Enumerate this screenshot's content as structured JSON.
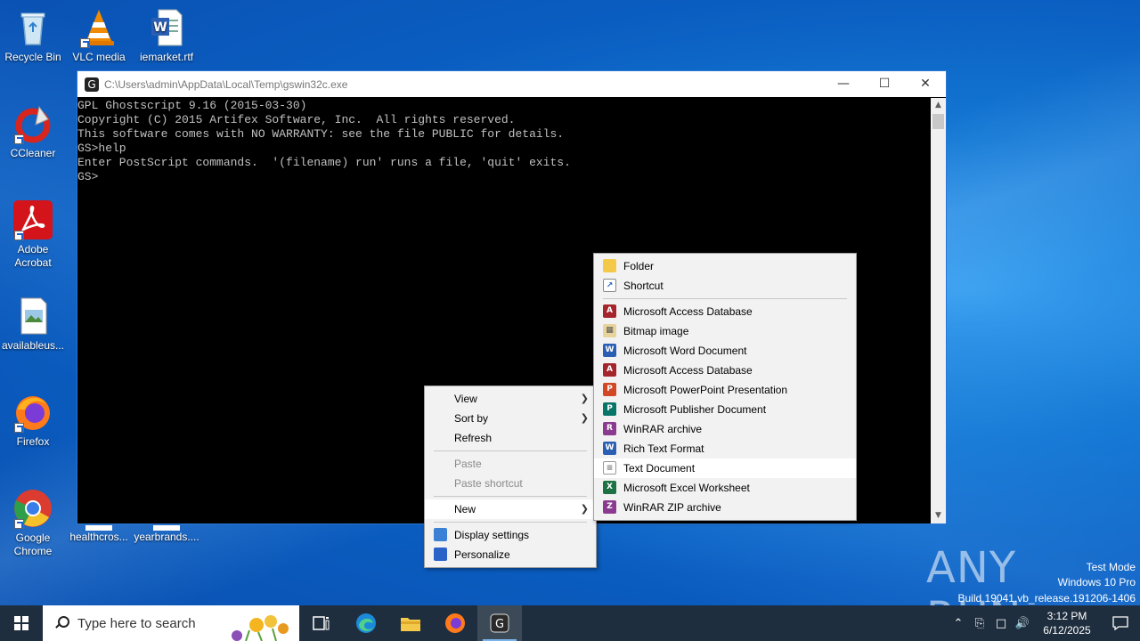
{
  "desktop": {
    "icons": [
      {
        "label": "Recycle Bin"
      },
      {
        "label": "VLC media"
      },
      {
        "label": "iemarket.rtf"
      },
      {
        "label": "CCleaner"
      },
      {
        "label": "Adobe Acrobat"
      },
      {
        "label": "availableus..."
      },
      {
        "label": "Firefox"
      },
      {
        "label": "Google Chrome"
      },
      {
        "label": "healthcros..."
      },
      {
        "label": "yearbrands...."
      }
    ]
  },
  "console": {
    "title": "C:\\Users\\admin\\AppData\\Local\\Temp\\gswin32c.exe",
    "lines": [
      "GPL Ghostscript 9.16 (2015-03-30)",
      "Copyright (C) 2015 Artifex Software, Inc.  All rights reserved.",
      "This software comes with NO WARRANTY: see the file PUBLIC for details.",
      "GS>help",
      "Enter PostScript commands.  '(filename) run' runs a file, 'quit' exits.",
      "GS>"
    ]
  },
  "context_menu": {
    "view": "View",
    "sort_by": "Sort by",
    "refresh": "Refresh",
    "paste": "Paste",
    "paste_shortcut": "Paste shortcut",
    "new": "New",
    "display_settings": "Display settings",
    "personalize": "Personalize"
  },
  "new_submenu": {
    "items": [
      {
        "label": "Folder",
        "icon": "folder-icon"
      },
      {
        "label": "Shortcut",
        "icon": "shortcut-icon"
      },
      {
        "label": "Microsoft Access Database",
        "icon": "access-icon"
      },
      {
        "label": "Bitmap image",
        "icon": "bitmap-icon"
      },
      {
        "label": "Microsoft Word Document",
        "icon": "word-icon"
      },
      {
        "label": "Microsoft Access Database",
        "icon": "access-icon"
      },
      {
        "label": "Microsoft PowerPoint Presentation",
        "icon": "powerpoint-icon"
      },
      {
        "label": "Microsoft Publisher Document",
        "icon": "publisher-icon"
      },
      {
        "label": "WinRAR archive",
        "icon": "winrar-icon"
      },
      {
        "label": "Rich Text Format",
        "icon": "rtf-icon"
      },
      {
        "label": "Text Document",
        "icon": "text-document-icon"
      },
      {
        "label": "Microsoft Excel Worksheet",
        "icon": "excel-icon"
      },
      {
        "label": "WinRAR ZIP archive",
        "icon": "winrar-zip-icon"
      }
    ],
    "highlighted": "Text Document"
  },
  "watermark": {
    "logo": "ANY RUN",
    "mode": "Test Mode",
    "os": "Windows 10 Pro",
    "build": "Build 19041.vb_release.191206-1406"
  },
  "taskbar": {
    "search_placeholder": "Type here to search",
    "time": "3:12 PM",
    "date": "6/12/2025"
  }
}
